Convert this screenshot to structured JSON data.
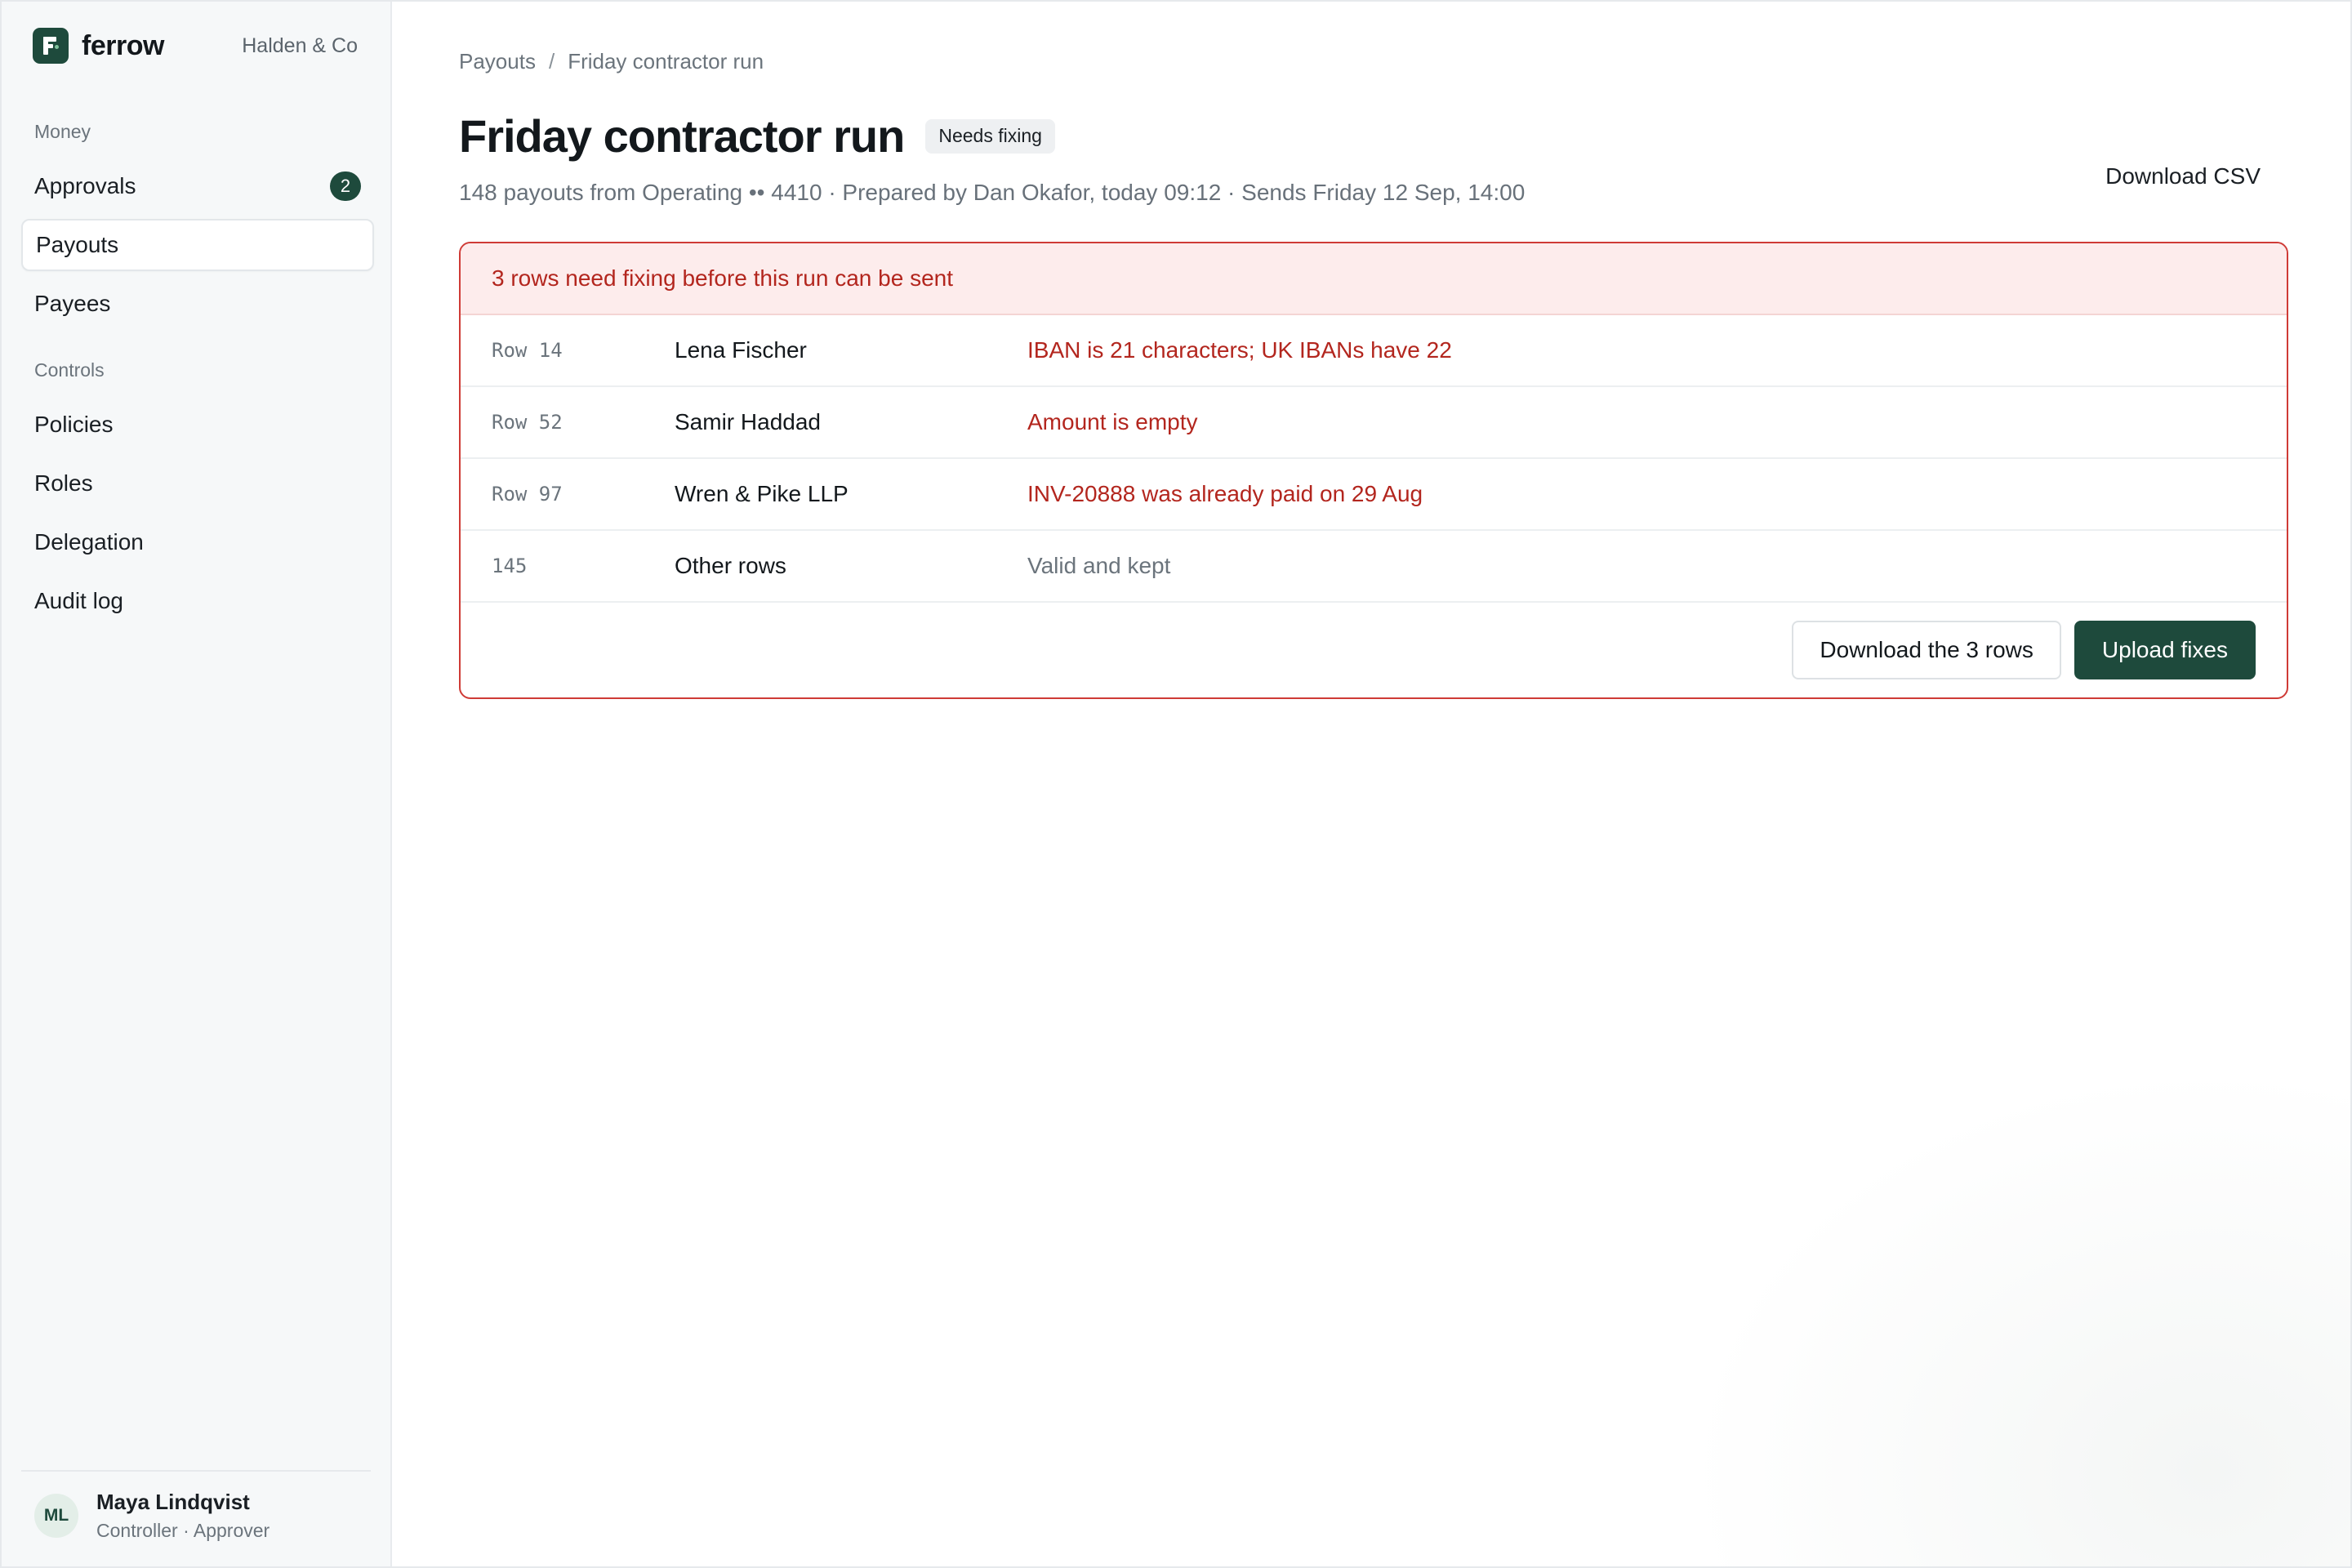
{
  "brand": {
    "name": "ferrow",
    "org": "Halden & Co",
    "colors": {
      "primary": "#1e4a3c",
      "error": "#b3261e"
    }
  },
  "sidebar": {
    "sections": [
      {
        "label": "Money",
        "items": [
          {
            "label": "Approvals",
            "badge": "2"
          },
          {
            "label": "Payouts",
            "active": true
          },
          {
            "label": "Payees"
          }
        ]
      },
      {
        "label": "Controls",
        "items": [
          {
            "label": "Policies"
          },
          {
            "label": "Roles"
          },
          {
            "label": "Delegation"
          },
          {
            "label": "Audit log"
          }
        ]
      }
    ],
    "user": {
      "initials": "ML",
      "name": "Maya Lindqvist",
      "role": "Controller · Approver"
    }
  },
  "breadcrumb": {
    "parent": "Payouts",
    "separator": "/",
    "current": "Friday contractor run"
  },
  "header": {
    "title": "Friday contractor run",
    "status": "Needs fixing",
    "subtitle": "148 payouts from Operating •• 4410 · Prepared by Dan Okafor, today 09:12 · Sends Friday 12 Sep, 14:00",
    "download_csv": "Download CSV"
  },
  "errors": {
    "banner": "3 rows need fixing before this run can be sent",
    "rows": [
      {
        "row": "Row 14",
        "payee": "Lena Fischer",
        "issue": "IBAN is 21 characters; UK IBANs have 22"
      },
      {
        "row": "Row 52",
        "payee": "Samir Haddad",
        "issue": "Amount is empty"
      },
      {
        "row": "Row 97",
        "payee": "Wren & Pike LLP",
        "issue": "INV-20888 was already paid on 29 Aug"
      },
      {
        "row": "145",
        "payee": "Other rows",
        "issue": "Valid and kept"
      }
    ],
    "actions": {
      "download": "Download the 3 rows",
      "upload": "Upload fixes"
    }
  }
}
